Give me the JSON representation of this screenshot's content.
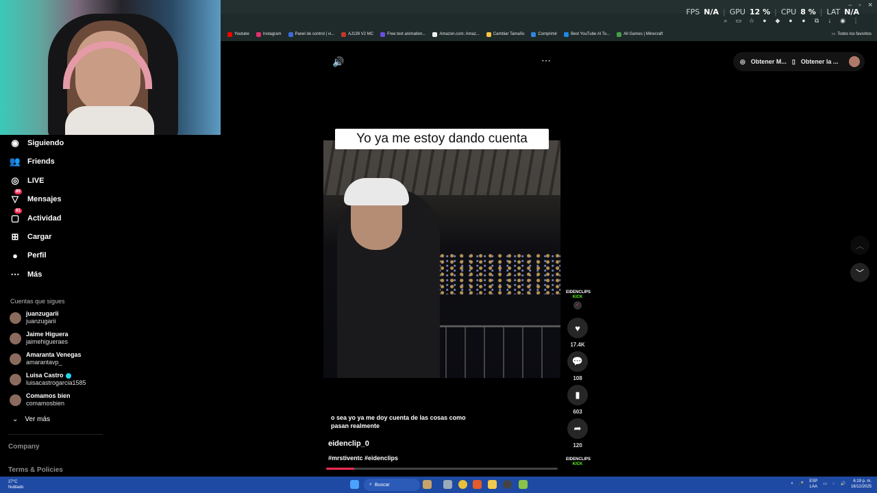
{
  "overlay": {
    "fps_label": "FPS",
    "fps_value": "N/A",
    "gpu_label": "GPU",
    "gpu_value": "12 %",
    "cpu_label": "CPU",
    "cpu_value": "8 %",
    "lat_label": "LAT",
    "lat_value": "N/A"
  },
  "bookmarks": [
    {
      "label": "Youtube",
      "color": "#ff0000"
    },
    {
      "label": "Instagram",
      "color": "#e1306c"
    },
    {
      "label": "Panel de control | vi...",
      "color": "#3b6bd6"
    },
    {
      "label": "AJ139 V2 MC",
      "color": "#c0392b"
    },
    {
      "label": "Free text animation...",
      "color": "#6a4de0"
    },
    {
      "label": "Amazon.com: Amaz...",
      "color": "#f0f0f0"
    },
    {
      "label": "Cambiar Tamaño",
      "color": "#f5c542"
    },
    {
      "label": "Comprimir",
      "color": "#2e86de"
    },
    {
      "label": "Best YouTube AI To...",
      "color": "#1e88e5"
    },
    {
      "label": "All Games | Minecraft",
      "color": "#43a047"
    }
  ],
  "bookmarks_all": "Todos los favoritos",
  "sidebar": {
    "nav": [
      {
        "label": "Siguiendo",
        "icon": "following-icon"
      },
      {
        "label": "Friends",
        "icon": "friends-icon"
      },
      {
        "label": "LIVE",
        "icon": "live-icon"
      },
      {
        "label": "Mensajes",
        "icon": "messages-icon",
        "badge": "89"
      },
      {
        "label": "Actividad",
        "icon": "activity-icon",
        "badge": "91"
      },
      {
        "label": "Cargar",
        "icon": "upload-icon"
      },
      {
        "label": "Perfil",
        "icon": "profile-icon"
      },
      {
        "label": "Más",
        "icon": "more-icon"
      }
    ],
    "following_title": "Cuentas que sigues",
    "following": [
      {
        "name": "juanzugarii",
        "handle": "juanzugarii",
        "verified": false
      },
      {
        "name": "Jaime Higuera",
        "handle": "jaimehigueraes",
        "verified": false
      },
      {
        "name": "Amaranta Venegas",
        "handle": "amarantavp_",
        "verified": false
      },
      {
        "name": "Luisa Castro",
        "handle": "luisacastrogarcia1585",
        "verified": true
      },
      {
        "name": "Comamos bien",
        "handle": "comamosbien",
        "verified": false
      }
    ],
    "see_more": "Ver más",
    "footer": [
      "Company",
      "Terms & Policies"
    ]
  },
  "top_actions": {
    "btn1": "Obtener M...",
    "btn2": "Obtener la ..."
  },
  "video": {
    "caption": "Yo ya me estoy dando cuenta",
    "description": "o sea yo ya me doy cuenta de las cosas como pasan realmente",
    "author": "eidenclip_0",
    "tags": "#mrstiventc #eidenclips",
    "progress": 0.12,
    "kick_line1": "EIDENCLIPS",
    "kick_line2": "KICK",
    "likes": "17.4K",
    "comments": "108",
    "saves": "603",
    "shares": "120"
  },
  "taskbar": {
    "temp": "27°C",
    "weather": "Nublado",
    "search_placeholder": "Buscar",
    "lang1": "ESP",
    "lang2": "LAA",
    "time": "6:19 p. m.",
    "date": "16/12/2025"
  },
  "colors": {
    "accent": "#fe2c55",
    "kick": "#53fc18",
    "taskbar": "#1f4aa3"
  }
}
